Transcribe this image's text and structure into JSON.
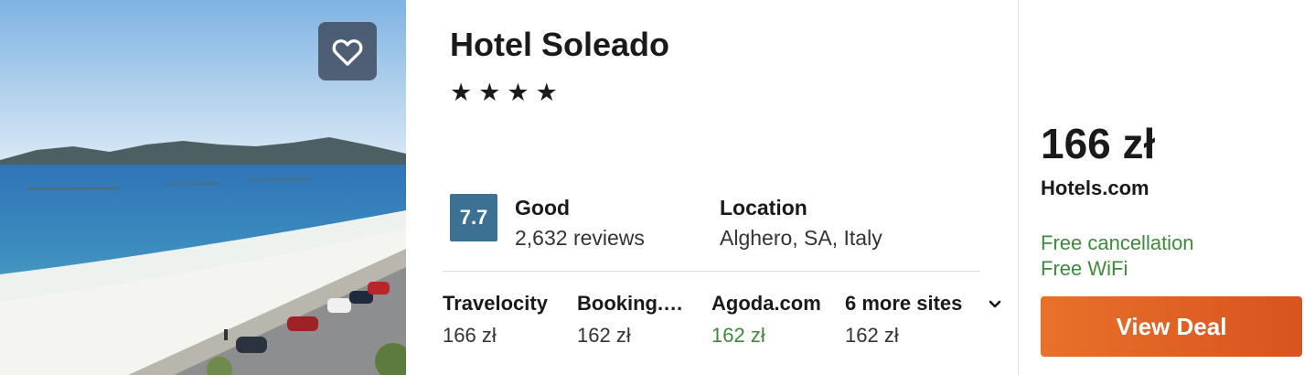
{
  "hotel": {
    "name": "Hotel Soleado",
    "stars": "★★★★",
    "star_count": 4
  },
  "rating": {
    "score": "7.7",
    "label": "Good",
    "reviews": "2,632 reviews",
    "color": "#3d7194"
  },
  "location": {
    "label": "Location",
    "value": "Alghero, SA, Italy"
  },
  "sites": [
    {
      "name": "Travelocity",
      "price": "166 zł"
    },
    {
      "name": "Booking.…",
      "price": "162 zł"
    },
    {
      "name": "Agoda.com",
      "price": "162 zł",
      "price_color": "#3d8a3a"
    },
    {
      "name": "6 more sites",
      "price": "162 zł"
    }
  ],
  "deal": {
    "price": "166 zł",
    "provider": "Hotels.com",
    "features": [
      "Free cancellation",
      "Free WiFi"
    ],
    "feature_color": "#3d8a3a",
    "button_label": "View Deal",
    "button_color": "#e0642a"
  },
  "icons": {
    "favorite": "heart-outline-icon",
    "more_sites": "chevron-down-icon"
  }
}
